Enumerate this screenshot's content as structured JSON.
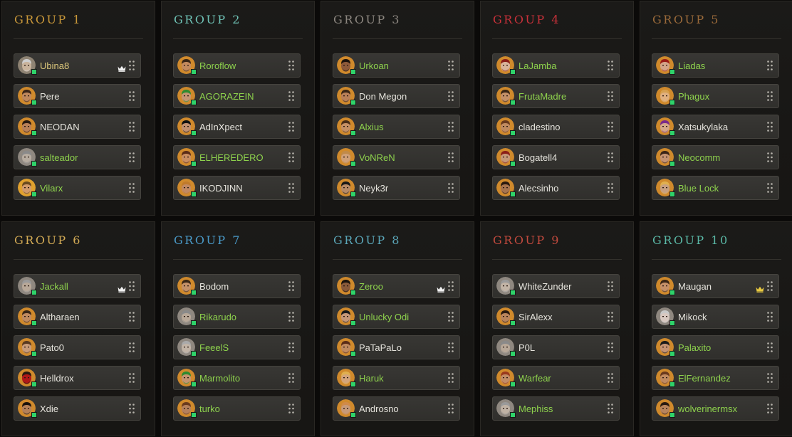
{
  "colors": {
    "name_gold": "#ddc87c",
    "name_green": "#8ed24d",
    "name_white": "#e5e3dc",
    "online": "#2fd36a",
    "crown_white": "#f2f2f2",
    "crown_gold": "#e7c940"
  },
  "groups": [
    {
      "title": "GROUP 1",
      "title_color": "#c9983a",
      "players": [
        {
          "name": "Ubina8",
          "name_color": "gold",
          "leader": true,
          "crown": "white",
          "avatar": {
            "skin": "#c9b39b",
            "hair": "#cfcfcf",
            "bg": "#8e8373"
          }
        },
        {
          "name": "Pere",
          "name_color": "white",
          "leader": false,
          "avatar": {
            "skin": "#bf875c",
            "hair": "#3a2418",
            "bg": "#d08a2c"
          }
        },
        {
          "name": "NEODAN",
          "name_color": "white",
          "leader": false,
          "avatar": {
            "skin": "#b98058",
            "hair": "#2a1a10",
            "bg": "#d08a2c"
          }
        },
        {
          "name": "salteador",
          "name_color": "green",
          "leader": false,
          "avatar": {
            "skin": "#b7aca0",
            "hair": "#8a8a8a",
            "bg": "#8f8880"
          }
        },
        {
          "name": "Vilarx",
          "name_color": "green",
          "leader": false,
          "avatar": {
            "skin": "#d19a6b",
            "hair": "#6a4a1e",
            "bg": "#e0a12e"
          }
        }
      ]
    },
    {
      "title": "GROUP 2",
      "title_color": "#6fc3b6",
      "players": [
        {
          "name": "Roroflow",
          "name_color": "green",
          "leader": false,
          "avatar": {
            "skin": "#c48a5e",
            "hair": "#3a2616",
            "bg": "#d08a2c"
          }
        },
        {
          "name": "AGORAZEIN",
          "name_color": "green",
          "leader": false,
          "avatar": {
            "skin": "#c59573",
            "hair": "#2f8a2f",
            "bg": "#d08a2c"
          }
        },
        {
          "name": "AdInXpect",
          "name_color": "white",
          "leader": false,
          "avatar": {
            "skin": "#c29070",
            "hair": "#111111",
            "bg": "#d08a2c"
          }
        },
        {
          "name": "ELHEREDERO",
          "name_color": "green",
          "leader": false,
          "avatar": {
            "skin": "#c98e62",
            "hair": "#5a2c18",
            "bg": "#d08a2c"
          }
        },
        {
          "name": "IKODJINN",
          "name_color": "white",
          "leader": false,
          "avatar": {
            "skin": "#c28962",
            "hair": "#c07a2c",
            "bg": "#d08a2c"
          }
        }
      ]
    },
    {
      "title": "GROUP 3",
      "title_color": "#8c8780",
      "players": [
        {
          "name": "Urkoan",
          "name_color": "green",
          "leader": false,
          "avatar": {
            "skin": "#8e5a3a",
            "hair": "#1c120c",
            "bg": "#d08a2c"
          }
        },
        {
          "name": "Don Megon",
          "name_color": "white",
          "leader": false,
          "avatar": {
            "skin": "#b98058",
            "hair": "#3a2616",
            "bg": "#d08a2c"
          }
        },
        {
          "name": "Alxius",
          "name_color": "green",
          "leader": false,
          "avatar": {
            "skin": "#c59065",
            "hair": "#4a2e18",
            "bg": "#d08a2c"
          }
        },
        {
          "name": "VoNReN",
          "name_color": "green",
          "leader": false,
          "avatar": {
            "skin": "#d0a078",
            "hair": "#c08a4a",
            "bg": "#d08a2c"
          }
        },
        {
          "name": "Neyk3r",
          "name_color": "white",
          "leader": false,
          "avatar": {
            "skin": "#b78a66",
            "hair": "#181818",
            "bg": "#d08a2c"
          }
        }
      ]
    },
    {
      "title": "GROUP 4",
      "title_color": "#c8313a",
      "players": [
        {
          "name": "LaJamba",
          "name_color": "green",
          "leader": false,
          "avatar": {
            "skin": "#d8b49a",
            "hair": "#8a1e18",
            "bg": "#d08a2c"
          }
        },
        {
          "name": "FrutaMadre",
          "name_color": "green",
          "leader": false,
          "avatar": {
            "skin": "#c49068",
            "hair": "#3a2616",
            "bg": "#d08a2c"
          }
        },
        {
          "name": "cladestino",
          "name_color": "white",
          "leader": false,
          "avatar": {
            "skin": "#c08a60",
            "hair": "#6a3a1e",
            "bg": "#d08a2c"
          }
        },
        {
          "name": "Bogatell4",
          "name_color": "white",
          "leader": false,
          "avatar": {
            "skin": "#c69878",
            "hair": "#8a1e18",
            "bg": "#d08a2c"
          }
        },
        {
          "name": "Alecsinho",
          "name_color": "white",
          "leader": false,
          "avatar": {
            "skin": "#a8744e",
            "hair": "#2a1a10",
            "bg": "#d08a2c"
          }
        }
      ]
    },
    {
      "title": "GROUP 5",
      "title_color": "#9a6a3a",
      "players": [
        {
          "name": "Liadas",
          "name_color": "green",
          "leader": false,
          "avatar": {
            "skin": "#d3a588",
            "hair": "#9a1c16",
            "bg": "#d08a2c"
          }
        },
        {
          "name": "Phagux",
          "name_color": "green",
          "leader": false,
          "avatar": {
            "skin": "#e0b080",
            "hair": "#d6a050",
            "bg": "#d08a2c"
          }
        },
        {
          "name": "Xatsukylaka",
          "name_color": "white",
          "leader": false,
          "avatar": {
            "skin": "#d5a889",
            "hair": "#7a2a8a",
            "bg": "#d08a2c"
          }
        },
        {
          "name": "Neocomm",
          "name_color": "green",
          "leader": false,
          "avatar": {
            "skin": "#c59373",
            "hair": "#3a2418",
            "bg": "#d08a2c"
          }
        },
        {
          "name": "Blue Lock",
          "name_color": "green",
          "leader": false,
          "avatar": {
            "skin": "#c8a080",
            "hair": "#e0b050",
            "bg": "#d08a2c"
          }
        }
      ]
    },
    {
      "title": "GROUP 6",
      "title_color": "#d2aa55",
      "players": [
        {
          "name": "Jackall",
          "name_color": "green",
          "leader": true,
          "crown": "white",
          "avatar": {
            "skin": "#b8a898",
            "hair": "#9a9a9a",
            "bg": "#8f8880"
          }
        },
        {
          "name": "Altharaen",
          "name_color": "white",
          "leader": false,
          "avatar": {
            "skin": "#c08a60",
            "hair": "#3a2616",
            "bg": "#d08a2c"
          }
        },
        {
          "name": "Pato0",
          "name_color": "white",
          "leader": false,
          "avatar": {
            "skin": "#c99c7a",
            "hair": "#5a3a20",
            "bg": "#d08a2c"
          }
        },
        {
          "name": "Helldrox",
          "name_color": "white",
          "leader": false,
          "avatar": {
            "skin": "#b01818",
            "hair": "#2a1a10",
            "bg": "#d08a2c"
          }
        },
        {
          "name": "Xdie",
          "name_color": "white",
          "leader": false,
          "avatar": {
            "skin": "#b48058",
            "hair": "#1a120c",
            "bg": "#d08a2c"
          }
        }
      ]
    },
    {
      "title": "GROUP 7",
      "title_color": "#4a9ac8",
      "players": [
        {
          "name": "Bodom",
          "name_color": "white",
          "leader": false,
          "avatar": {
            "skin": "#c49068",
            "hair": "#3a2616",
            "bg": "#d08a2c"
          }
        },
        {
          "name": "Rikarudo",
          "name_color": "green",
          "leader": false,
          "avatar": {
            "skin": "#b8a898",
            "hair": "#8a8a8a",
            "bg": "#8f8880"
          }
        },
        {
          "name": "FeeelS",
          "name_color": "green",
          "leader": false,
          "avatar": {
            "skin": "#c2b4a6",
            "hair": "#aaaaaa",
            "bg": "#8f8880"
          }
        },
        {
          "name": "Marmolito",
          "name_color": "green",
          "leader": false,
          "avatar": {
            "skin": "#c49470",
            "hair": "#2f8a2f",
            "bg": "#d08a2c"
          }
        },
        {
          "name": "turko",
          "name_color": "green",
          "leader": false,
          "avatar": {
            "skin": "#b5805c",
            "hair": "#6a3a1e",
            "bg": "#d08a2c"
          }
        }
      ]
    },
    {
      "title": "GROUP 8",
      "title_color": "#5aa6b8",
      "players": [
        {
          "name": "Zeroo",
          "name_color": "green",
          "leader": true,
          "crown": "white",
          "avatar": {
            "skin": "#8a5a3a",
            "hair": "#1a120c",
            "bg": "#d08a2c"
          }
        },
        {
          "name": "Unlucky Odi",
          "name_color": "green",
          "leader": false,
          "avatar": {
            "skin": "#c69878",
            "hair": "#1a1a1a",
            "bg": "#d08a2c"
          }
        },
        {
          "name": "PaTaPaLo",
          "name_color": "white",
          "leader": false,
          "avatar": {
            "skin": "#c08a60",
            "hair": "#5a2c18",
            "bg": "#d08a2c"
          }
        },
        {
          "name": "Haruk",
          "name_color": "green",
          "leader": false,
          "avatar": {
            "skin": "#d4a47a",
            "hair": "#e0b050",
            "bg": "#d08a2c"
          }
        },
        {
          "name": "Androsno",
          "name_color": "white",
          "leader": false,
          "avatar": {
            "skin": "#c89a78",
            "hair": "#d08a4a",
            "bg": "#d08a2c"
          }
        }
      ]
    },
    {
      "title": "GROUP 9",
      "title_color": "#c24a3e",
      "players": [
        {
          "name": "WhiteZunder",
          "name_color": "white",
          "leader": false,
          "avatar": {
            "skin": "#c2b4a6",
            "hair": "#9a9a9a",
            "bg": "#8f8880"
          }
        },
        {
          "name": "SirAlexx",
          "name_color": "white",
          "leader": false,
          "avatar": {
            "skin": "#b8845c",
            "hair": "#2a1a10",
            "bg": "#d08a2c"
          }
        },
        {
          "name": "P0L",
          "name_color": "white",
          "leader": false,
          "avatar": {
            "skin": "#b8a898",
            "hair": "#8a8a8a",
            "bg": "#8f8880"
          }
        },
        {
          "name": "Warfear",
          "name_color": "green",
          "leader": false,
          "avatar": {
            "skin": "#c28c66",
            "hair": "#9a3a1e",
            "bg": "#d08a2c"
          }
        },
        {
          "name": "Mephiss",
          "name_color": "green",
          "leader": false,
          "avatar": {
            "skin": "#bfb2a4",
            "hair": "#9a9a9a",
            "bg": "#8f8880"
          }
        }
      ]
    },
    {
      "title": "GROUP 10",
      "title_color": "#5ab8a6",
      "players": [
        {
          "name": "Maugan",
          "name_color": "white",
          "leader": true,
          "crown": "gold",
          "avatar": {
            "skin": "#c49068",
            "hair": "#3a2616",
            "bg": "#d08a2c"
          }
        },
        {
          "name": "Mikock",
          "name_color": "white",
          "leader": false,
          "avatar": {
            "skin": "#d8c8c0",
            "hair": "#c8c8c8",
            "bg": "#8f8880"
          }
        },
        {
          "name": "Palaxito",
          "name_color": "green",
          "leader": false,
          "avatar": {
            "skin": "#c59373",
            "hair": "#1a1a1a",
            "bg": "#d08a2c"
          }
        },
        {
          "name": "ElFernandez",
          "name_color": "green",
          "leader": false,
          "avatar": {
            "skin": "#c08a60",
            "hair": "#6a3a1e",
            "bg": "#d08a2c"
          }
        },
        {
          "name": "wolverinermsx",
          "name_color": "green",
          "leader": false,
          "avatar": {
            "skin": "#b8845c",
            "hair": "#2a1a10",
            "bg": "#d08a2c"
          }
        }
      ]
    }
  ]
}
